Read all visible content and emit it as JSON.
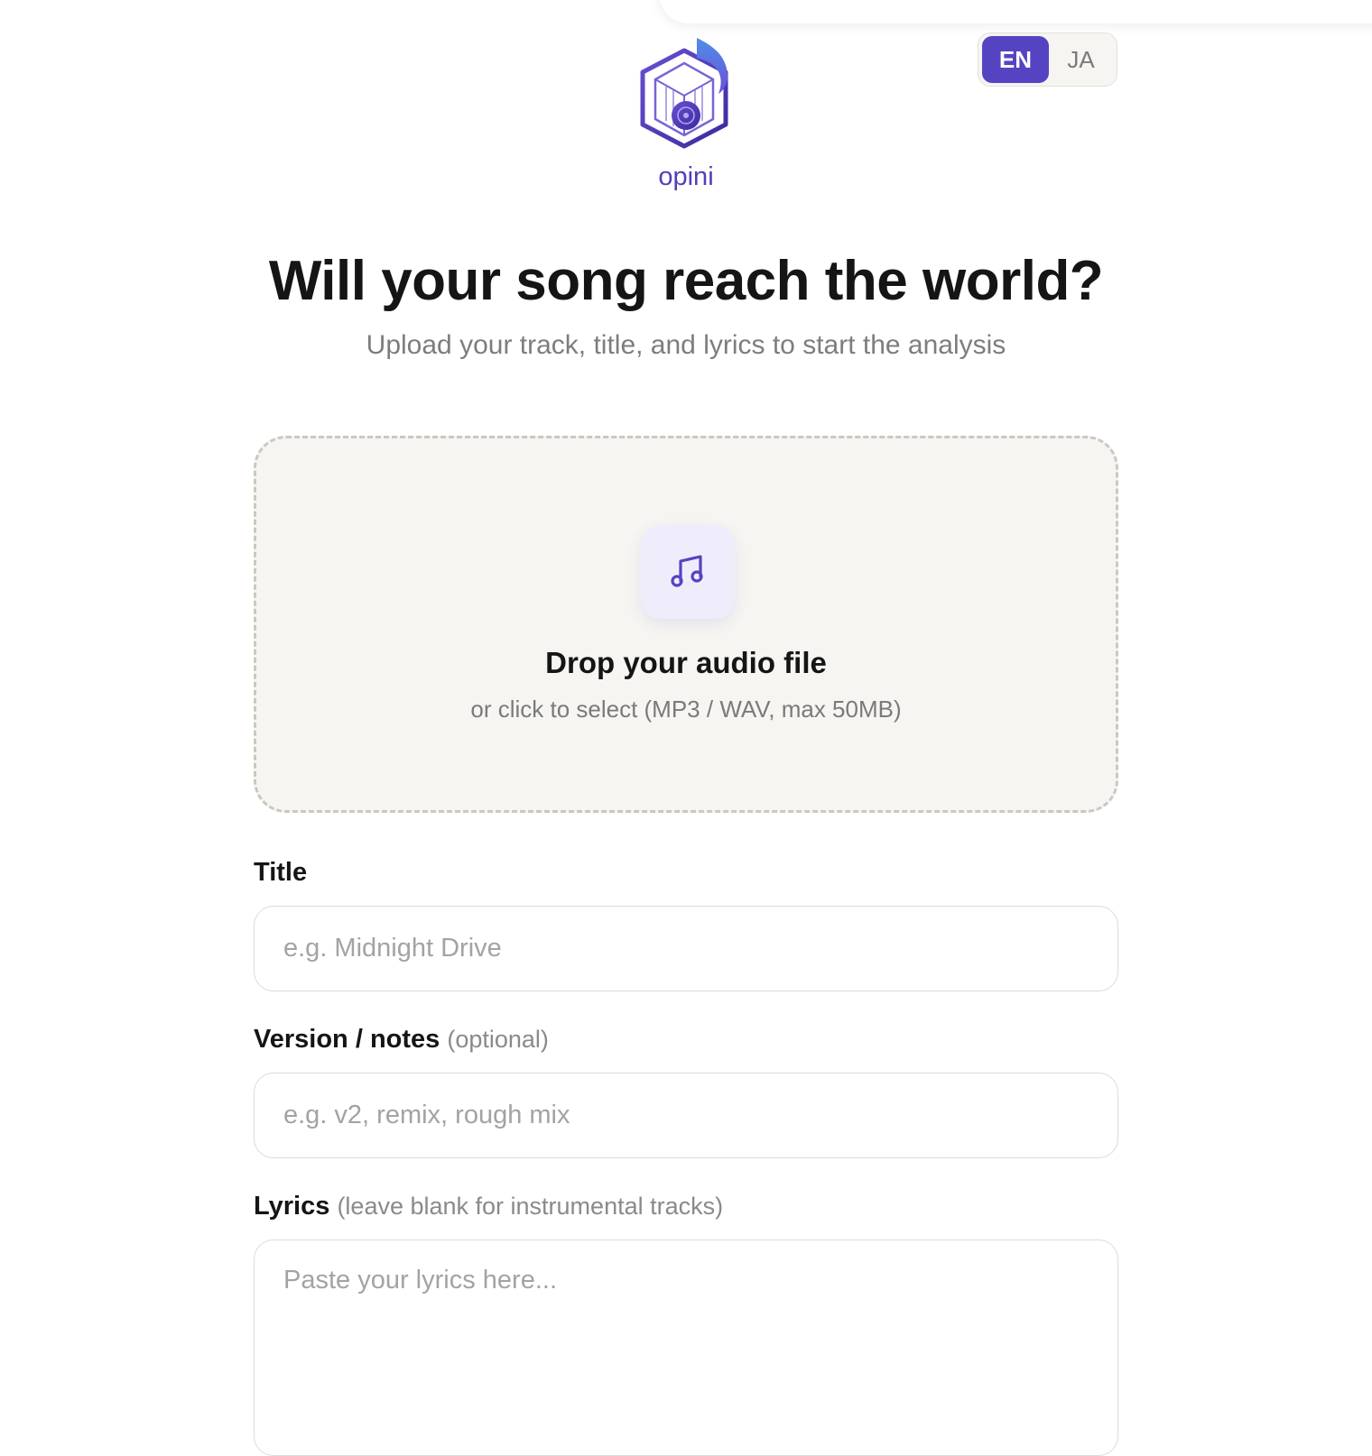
{
  "brand": {
    "name": "opini",
    "logo_icon": "music-note-hexagon-logo-icon"
  },
  "language_toggle": {
    "options": [
      {
        "label": "EN",
        "active": true
      },
      {
        "label": "JA",
        "active": false
      }
    ]
  },
  "hero": {
    "title": "Will your song reach the world?",
    "subtitle": "Upload your track, title, and lyrics to start the analysis"
  },
  "dropzone": {
    "icon": "music-note-icon",
    "title": "Drop your audio file",
    "subtitle": "or click to select (MP3 / WAV, max 50MB)"
  },
  "form": {
    "title": {
      "label": "Title",
      "value": "",
      "placeholder": "e.g. Midnight Drive"
    },
    "version": {
      "label": "Version / notes",
      "hint": "(optional)",
      "value": "",
      "placeholder": "e.g. v2, remix, rough mix"
    },
    "lyrics": {
      "label": "Lyrics",
      "hint": "(leave blank for instrumental tracks)",
      "value": "",
      "placeholder": "Paste your lyrics here..."
    }
  },
  "colors": {
    "accent": "#5544c2",
    "brand_text": "#5040b8",
    "dropzone_bg": "#f6f5f1",
    "page_bg": "#ffffff"
  }
}
